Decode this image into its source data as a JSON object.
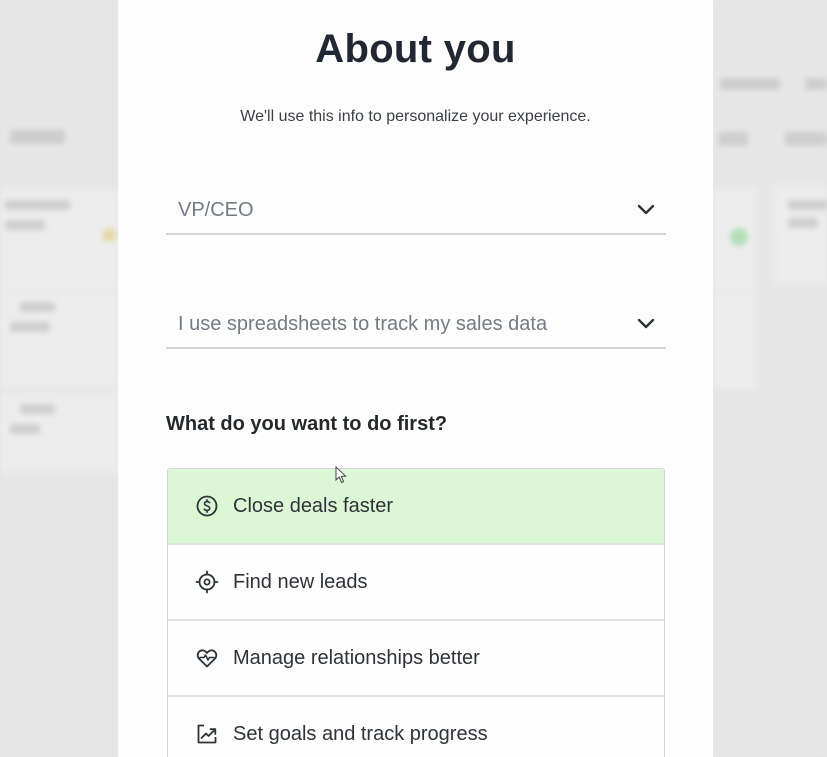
{
  "modal": {
    "title": "About you",
    "subtitle": "We'll use this info to personalize your experience."
  },
  "role_select": {
    "value": "VP/CEO",
    "icon": "chevron-down-icon"
  },
  "tracking_select": {
    "value": "I use spreadsheets to track my sales data",
    "icon": "chevron-down-icon"
  },
  "goals": {
    "question": "What do you want to do first?",
    "options": [
      {
        "label": "Close deals faster",
        "icon": "dollar-circle-icon",
        "selected": true
      },
      {
        "label": "Find new leads",
        "icon": "crosshair-icon",
        "selected": false
      },
      {
        "label": "Manage relationships better",
        "icon": "heart-pulse-icon",
        "selected": false
      },
      {
        "label": "Set goals and track progress",
        "icon": "trend-up-icon",
        "selected": false
      }
    ]
  },
  "colors": {
    "selected_option_bg": "#dcf7d6",
    "title": "#222833",
    "divider": "#d3d5d8"
  }
}
